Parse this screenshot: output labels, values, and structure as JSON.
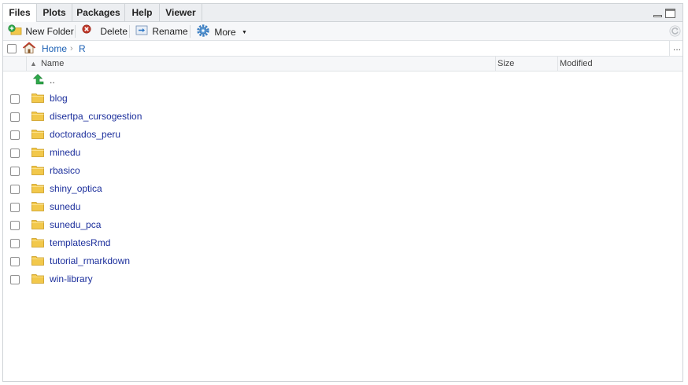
{
  "tabs": [
    {
      "label": "Files",
      "active": true
    },
    {
      "label": "Plots",
      "active": false
    },
    {
      "label": "Packages",
      "active": false
    },
    {
      "label": "Help",
      "active": false
    },
    {
      "label": "Viewer",
      "active": false
    }
  ],
  "toolbar": {
    "new_folder": "New Folder",
    "delete": "Delete",
    "rename": "Rename",
    "more": "More"
  },
  "path": {
    "home": "Home",
    "current": "R",
    "more": "..."
  },
  "columns": {
    "name": "Name",
    "size": "Size",
    "modified": "Modified"
  },
  "parent_dir": "..",
  "files": [
    "blog",
    "disertpa_cursogestion",
    "doctorados_peru",
    "minedu",
    "rbasico",
    "shiny_optica",
    "sunedu",
    "sunedu_pca",
    "templatesRmd",
    "tutorial_rmarkdown",
    "win-library"
  ],
  "icons": {
    "folder": "folder-icon",
    "parent": "up-arrow-icon",
    "home": "home-icon",
    "new_folder": "new-folder-icon",
    "delete": "delete-icon",
    "rename": "rename-icon",
    "more": "gear-icon",
    "refresh": "refresh-icon"
  },
  "colors": {
    "link": "#1c2f9c",
    "folder": "#f2c84b",
    "delete": "#c0392b",
    "parent_arrow": "#2ea84a"
  }
}
